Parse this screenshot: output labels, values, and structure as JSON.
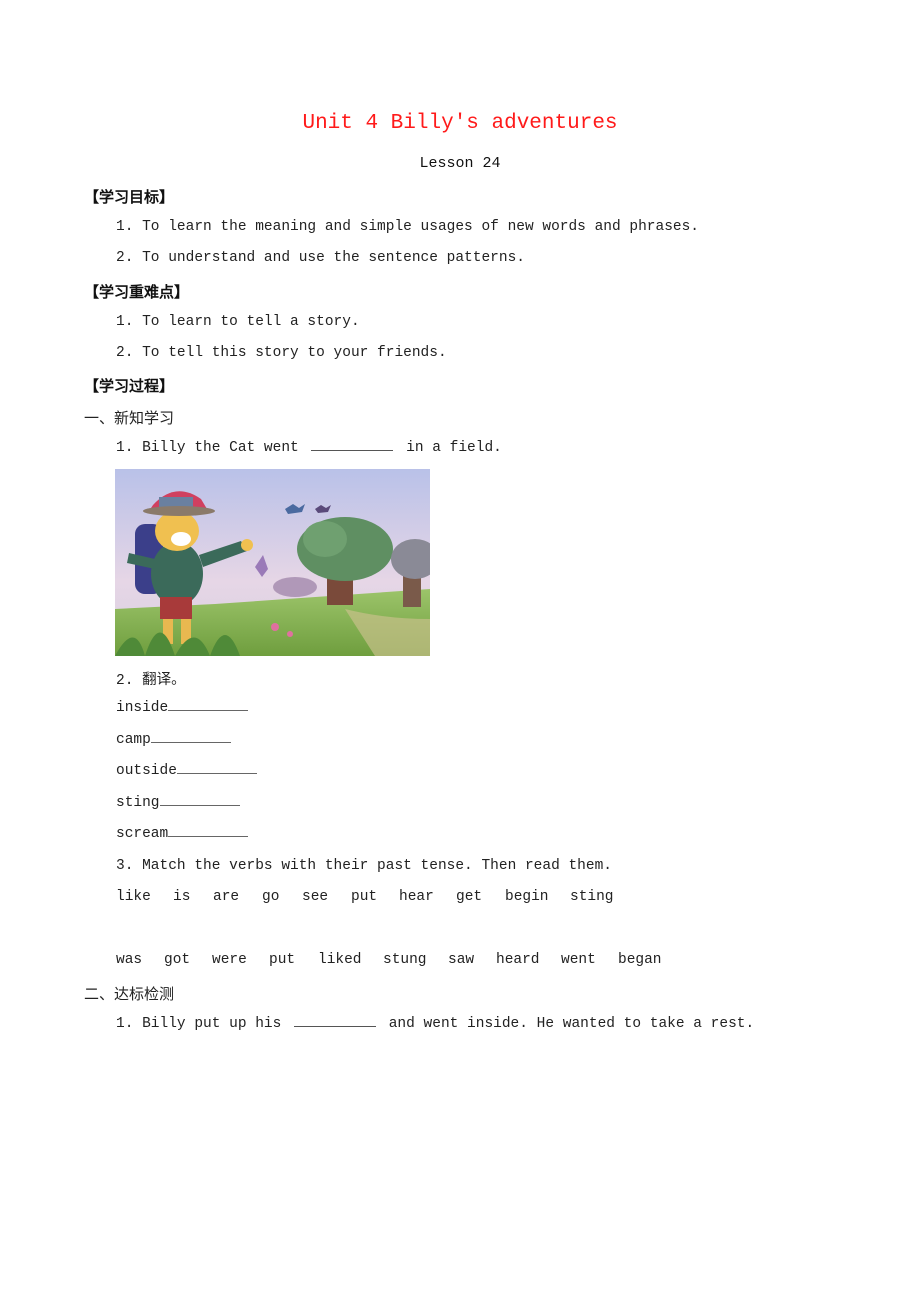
{
  "header": {
    "title": "Unit 4 Billy's adventures",
    "subtitle": "Lesson 24",
    "title_color": "#ff1a1a"
  },
  "objectives": {
    "heading": "【学习目标】",
    "items": [
      "1. To learn the meaning and simple usages of new words and phrases.",
      "2. To understand and use the sentence patterns."
    ]
  },
  "key_points": {
    "heading": "【学习重难点】",
    "items": [
      "1. To learn to tell a story.",
      "2. To tell this story to your friends."
    ]
  },
  "process": {
    "heading": "【学习过程】",
    "part1": {
      "heading": "一、新知学习",
      "q1": {
        "before": "1. Billy the Cat went",
        "after": "in a field."
      },
      "image": {
        "alt": "Billy the Cat with backpack and cap standing in a field with butterflies and trees"
      },
      "q2": {
        "heading": "2. 翻译。",
        "words": [
          "inside",
          "camp",
          "outside",
          "sting",
          "scream"
        ]
      },
      "q3": {
        "heading": "3. Match the verbs with their past tense. Then read them.",
        "verbs": [
          "like",
          "is",
          "are",
          "go",
          "see",
          "put",
          "hear",
          "get",
          "begin",
          "sting"
        ],
        "past": [
          "was",
          "got",
          "were",
          "put",
          "liked",
          "stung",
          "saw",
          "heard",
          "went",
          "began"
        ]
      }
    },
    "part2": {
      "heading": "二、达标检测",
      "q1": {
        "before": "1. Billy put up his",
        "after": "and went inside. He wanted to take a rest."
      }
    }
  }
}
